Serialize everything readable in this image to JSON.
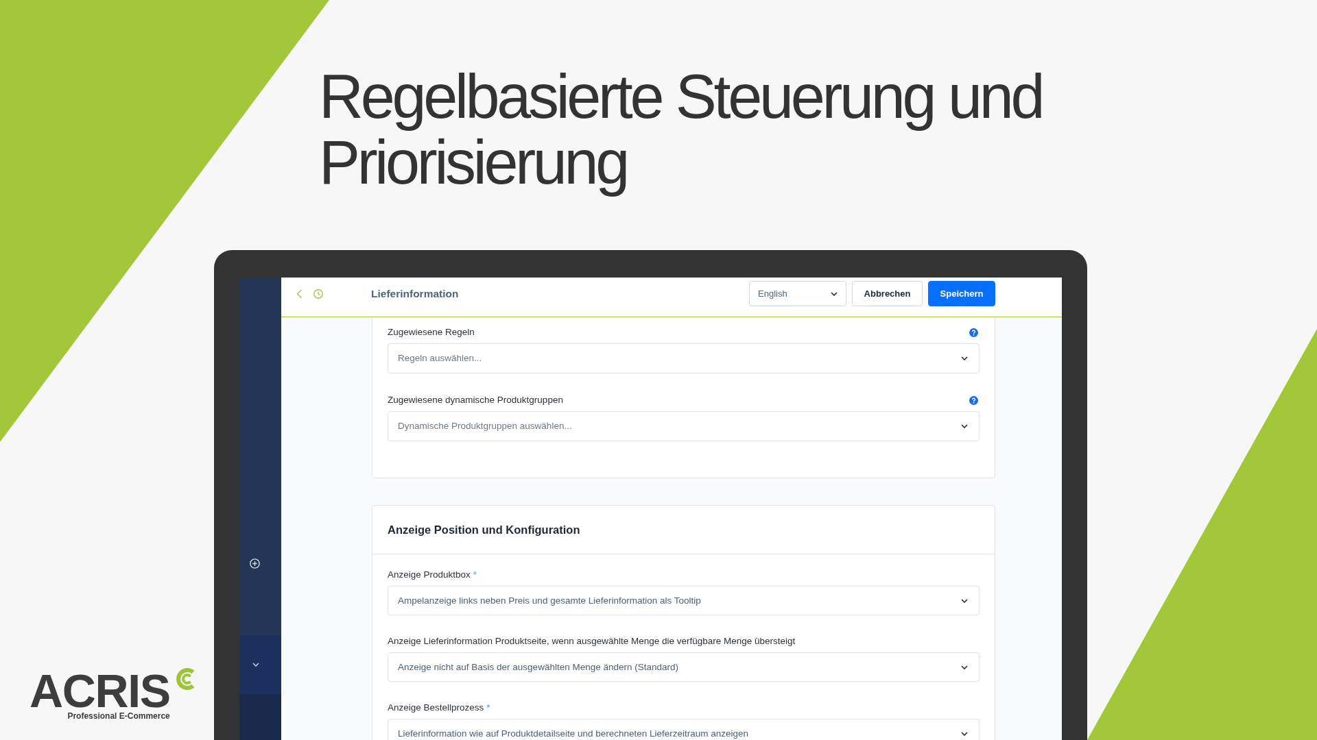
{
  "heading": "Regelbasierte Steuerung und Priorisierung",
  "app": {
    "header": {
      "title": "Lieferinformation",
      "language": "English",
      "buttons": [
        {
          "label": "Abbrechen",
          "kind": "secondary"
        },
        {
          "label": "Speichern",
          "kind": "primary"
        }
      ]
    },
    "sections": [
      {
        "fields": [
          {
            "label": "Zugewiesene Regeln",
            "help": true,
            "placeholder": "Regeln auswählen..."
          },
          {
            "label": "Zugewiesene dynamische Produktgruppen",
            "help": true,
            "placeholder": "Dynamische Produktgruppen auswählen..."
          }
        ]
      },
      {
        "title": "Anzeige Position und Konfiguration",
        "fields": [
          {
            "label": "Anzeige Produktbox",
            "required_mark": "*",
            "help": false,
            "value": "Ampelanzeige links neben Preis und gesamte Lieferinformation als Tooltip"
          },
          {
            "label": "Anzeige Lieferinformation Produktseite, wenn ausgewählte Menge die verfügbare Menge übersteigt",
            "help": false,
            "value": "Anzeige nicht auf Basis der ausgewählten Menge ändern (Standard)"
          },
          {
            "label": "Anzeige Bestellprozess",
            "required_mark": "*",
            "help": false,
            "value": "Lieferinformation wie auf Produktdetailseite und berechneten Lieferzeitraum anzeigen"
          }
        ]
      }
    ]
  },
  "logo": {
    "wordmark": "ACRIS",
    "tagline": "Professional E-Commerce"
  }
}
